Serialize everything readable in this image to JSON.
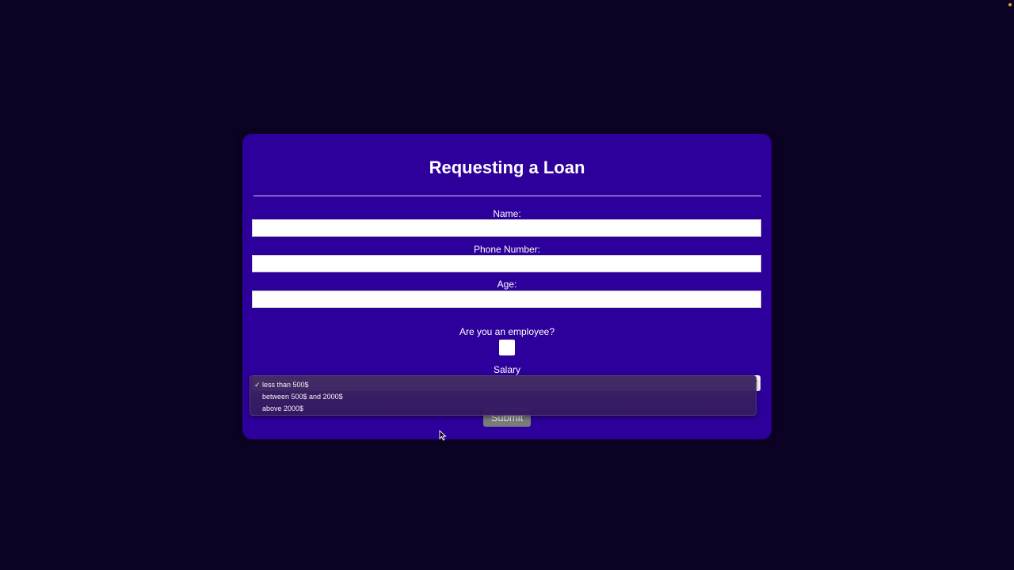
{
  "form": {
    "title": "Requesting a Loan",
    "name_label": "Name:",
    "name_value": "",
    "phone_label": "Phone Number:",
    "phone_value": "",
    "age_label": "Age:",
    "age_value": "",
    "employee_label": "Are you an employee?",
    "employee_checked": false,
    "salary_label": "Salary",
    "salary_selected": "less than 500$",
    "submit_label": "Submit"
  },
  "salary_dropdown": {
    "options": [
      {
        "label": "less than 500$",
        "selected": true
      },
      {
        "label": "between 500$ and 2000$",
        "selected": false
      },
      {
        "label": "above 2000$",
        "selected": false
      }
    ],
    "check_glyph": "✓"
  },
  "colors": {
    "page_background": "#0b0224",
    "card_background": "#2d009b",
    "text": "#ffffff",
    "submit_background": "#7b7b7b",
    "status_dot": "#e6a23c"
  }
}
